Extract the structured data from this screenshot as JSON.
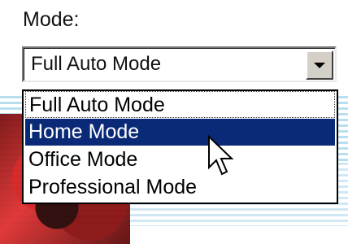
{
  "mode": {
    "label": "Mode:",
    "selected_value": "Full Auto Mode",
    "options": [
      "Full Auto Mode",
      "Home Mode",
      "Office Mode",
      "Professional Mode"
    ],
    "highlighted": "Home Mode"
  },
  "icons": {
    "dropdown_arrow": "chevron-down-icon",
    "pointer": "mouse-pointer-icon"
  },
  "colors": {
    "highlight": "#0a2a78",
    "highlight_text": "#ffffff",
    "button_face": "#d4d0c8"
  }
}
